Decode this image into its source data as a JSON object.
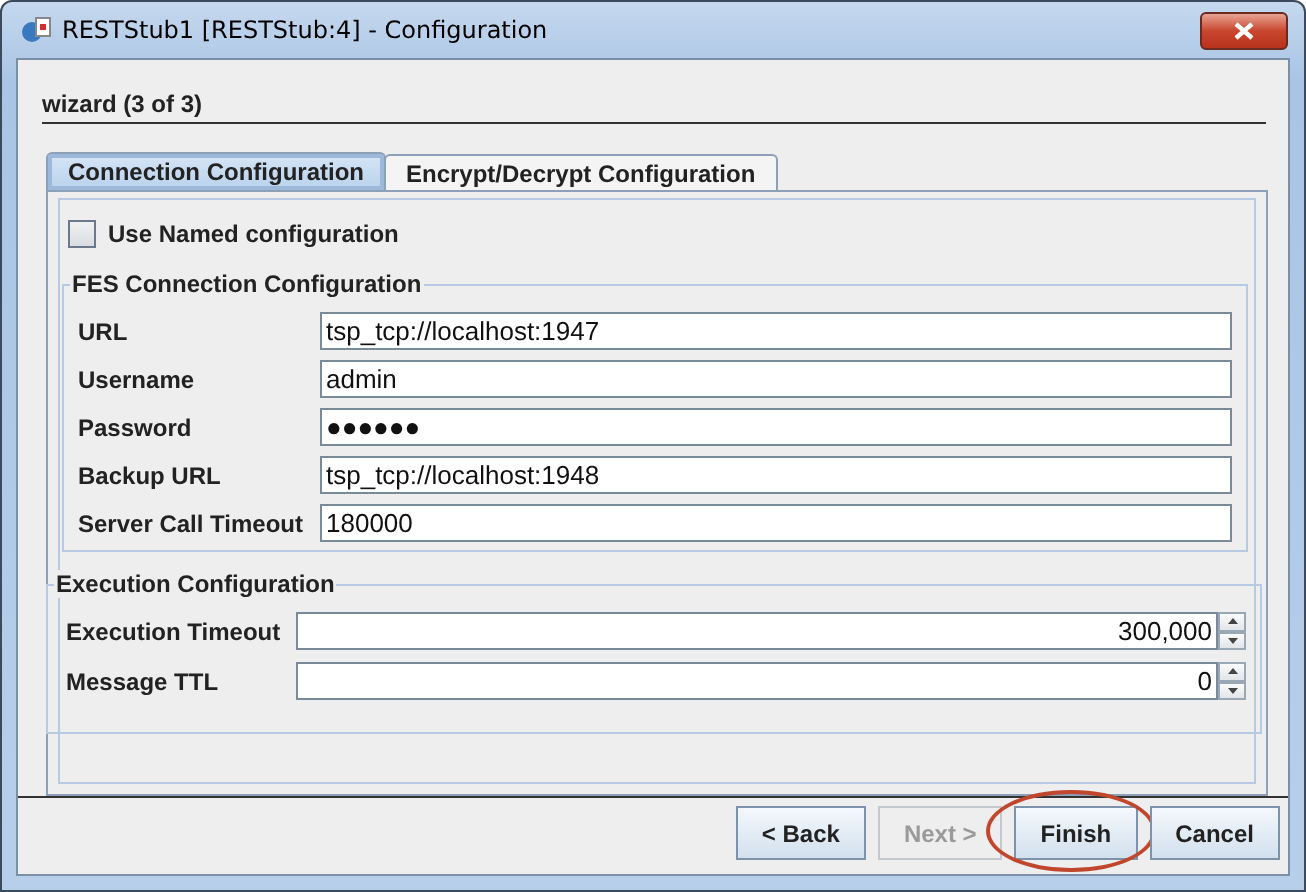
{
  "window": {
    "title": "RESTStub1 [RESTStub:4] - Configuration"
  },
  "wizard": {
    "step": "wizard (3 of 3)"
  },
  "tabs": [
    {
      "label": "Connection Configuration",
      "selected": true
    },
    {
      "label": "Encrypt/Decrypt Configuration",
      "selected": false
    }
  ],
  "use_named": {
    "label": "Use Named configuration",
    "checked": false
  },
  "fes_connection": {
    "title": "FES Connection Configuration",
    "fields": [
      {
        "label": "URL",
        "value": "tsp_tcp://localhost:1947"
      },
      {
        "label": "Username",
        "value": "admin"
      },
      {
        "label": "Password",
        "value": "●●●●●●"
      },
      {
        "label": "Backup URL",
        "value": "tsp_tcp://localhost:1948"
      },
      {
        "label": "Server Call Timeout",
        "value": "180000"
      }
    ]
  },
  "execution": {
    "title": "Execution Configuration",
    "fields": [
      {
        "label": "Execution Timeout",
        "value": "300,000"
      },
      {
        "label": "Message TTL",
        "value": "0"
      }
    ]
  },
  "buttons": [
    {
      "label": "< Back",
      "disabled": false,
      "highlighted": false
    },
    {
      "label": "Next >",
      "disabled": true,
      "highlighted": false
    },
    {
      "label": "Finish",
      "disabled": false,
      "highlighted": true
    },
    {
      "label": "Cancel",
      "disabled": false,
      "highlighted": false
    }
  ]
}
